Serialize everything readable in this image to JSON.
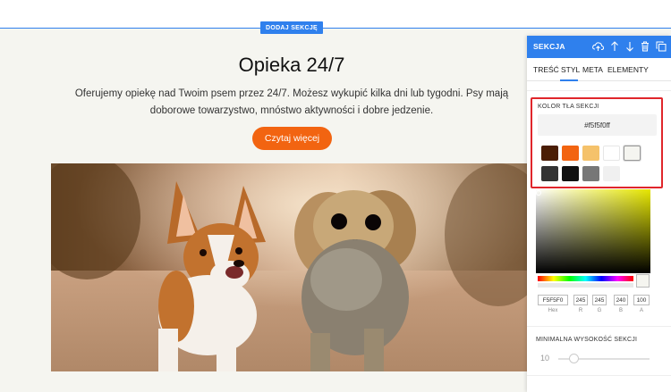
{
  "canvas": {
    "add_section_label": "DODAJ SEKCJĘ",
    "title": "Opieka 24/7",
    "description": "Oferujemy opiekę nad Twoim psem przez 24/7. Możesz wykupić kilka dni lub tygodni. Psy mają doborowe towarzystwo, mnóstwo aktywności i dobre jedzenie.",
    "cta_label": "Czytaj więcej",
    "background_color": "#f5f5f0",
    "accent_color": "#f26411"
  },
  "panel": {
    "title": "SEKCJA",
    "header_color": "#2f80ed",
    "icons": [
      "cloud-upload-icon",
      "arrow-up-icon",
      "arrow-down-icon",
      "trash-icon",
      "copy-icon"
    ],
    "tabs": [
      {
        "label": "TREŚĆ"
      },
      {
        "label": "STYL"
      },
      {
        "label": "META"
      },
      {
        "label": "ELEMENTY"
      }
    ],
    "active_tab": "STYL",
    "color_section": {
      "label": "KOLOR TŁA SEKCJI",
      "hex_value": "#f5f5f0ff",
      "swatches": [
        "#4a1d05",
        "#f26411",
        "#f5c26b",
        "#ffffff",
        "#f5f5f0",
        "#333333",
        "#111111",
        "#777777",
        "#f0f0f0"
      ],
      "selected_swatch": 4
    },
    "picker": {
      "hex": "F5F5F0",
      "r": "245",
      "g": "245",
      "b": "240",
      "a": "100",
      "hex_label": "Hex",
      "r_label": "R",
      "g_label": "G",
      "b_label": "B",
      "a_label": "A"
    },
    "min_height": {
      "label": "MINIMALNA WYSOKOŚĆ SEKCJI",
      "value": "10"
    }
  }
}
